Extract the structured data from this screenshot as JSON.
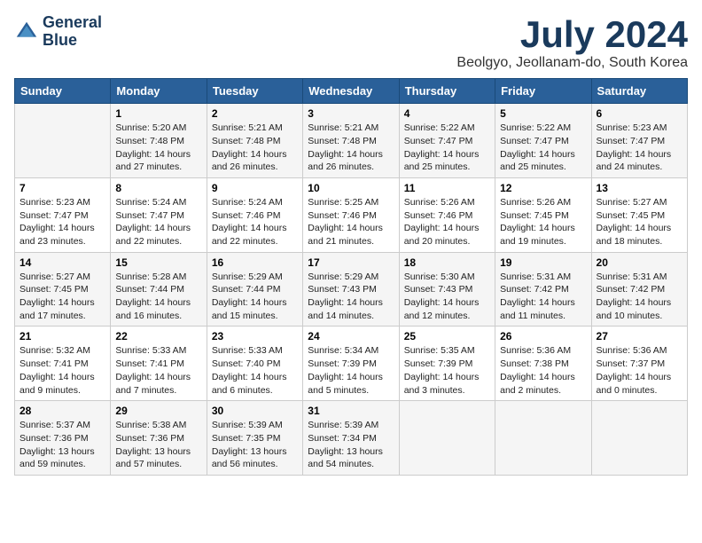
{
  "header": {
    "logo_line1": "General",
    "logo_line2": "Blue",
    "month_title": "July 2024",
    "location": "Beolgyo, Jeollanam-do, South Korea"
  },
  "weekdays": [
    "Sunday",
    "Monday",
    "Tuesday",
    "Wednesday",
    "Thursday",
    "Friday",
    "Saturday"
  ],
  "weeks": [
    [
      {
        "day": "",
        "sunrise": "",
        "sunset": "",
        "daylight": ""
      },
      {
        "day": "1",
        "sunrise": "Sunrise: 5:20 AM",
        "sunset": "Sunset: 7:48 PM",
        "daylight": "Daylight: 14 hours and 27 minutes."
      },
      {
        "day": "2",
        "sunrise": "Sunrise: 5:21 AM",
        "sunset": "Sunset: 7:48 PM",
        "daylight": "Daylight: 14 hours and 26 minutes."
      },
      {
        "day": "3",
        "sunrise": "Sunrise: 5:21 AM",
        "sunset": "Sunset: 7:48 PM",
        "daylight": "Daylight: 14 hours and 26 minutes."
      },
      {
        "day": "4",
        "sunrise": "Sunrise: 5:22 AM",
        "sunset": "Sunset: 7:47 PM",
        "daylight": "Daylight: 14 hours and 25 minutes."
      },
      {
        "day": "5",
        "sunrise": "Sunrise: 5:22 AM",
        "sunset": "Sunset: 7:47 PM",
        "daylight": "Daylight: 14 hours and 25 minutes."
      },
      {
        "day": "6",
        "sunrise": "Sunrise: 5:23 AM",
        "sunset": "Sunset: 7:47 PM",
        "daylight": "Daylight: 14 hours and 24 minutes."
      }
    ],
    [
      {
        "day": "7",
        "sunrise": "Sunrise: 5:23 AM",
        "sunset": "Sunset: 7:47 PM",
        "daylight": "Daylight: 14 hours and 23 minutes."
      },
      {
        "day": "8",
        "sunrise": "Sunrise: 5:24 AM",
        "sunset": "Sunset: 7:47 PM",
        "daylight": "Daylight: 14 hours and 22 minutes."
      },
      {
        "day": "9",
        "sunrise": "Sunrise: 5:24 AM",
        "sunset": "Sunset: 7:46 PM",
        "daylight": "Daylight: 14 hours and 22 minutes."
      },
      {
        "day": "10",
        "sunrise": "Sunrise: 5:25 AM",
        "sunset": "Sunset: 7:46 PM",
        "daylight": "Daylight: 14 hours and 21 minutes."
      },
      {
        "day": "11",
        "sunrise": "Sunrise: 5:26 AM",
        "sunset": "Sunset: 7:46 PM",
        "daylight": "Daylight: 14 hours and 20 minutes."
      },
      {
        "day": "12",
        "sunrise": "Sunrise: 5:26 AM",
        "sunset": "Sunset: 7:45 PM",
        "daylight": "Daylight: 14 hours and 19 minutes."
      },
      {
        "day": "13",
        "sunrise": "Sunrise: 5:27 AM",
        "sunset": "Sunset: 7:45 PM",
        "daylight": "Daylight: 14 hours and 18 minutes."
      }
    ],
    [
      {
        "day": "14",
        "sunrise": "Sunrise: 5:27 AM",
        "sunset": "Sunset: 7:45 PM",
        "daylight": "Daylight: 14 hours and 17 minutes."
      },
      {
        "day": "15",
        "sunrise": "Sunrise: 5:28 AM",
        "sunset": "Sunset: 7:44 PM",
        "daylight": "Daylight: 14 hours and 16 minutes."
      },
      {
        "day": "16",
        "sunrise": "Sunrise: 5:29 AM",
        "sunset": "Sunset: 7:44 PM",
        "daylight": "Daylight: 14 hours and 15 minutes."
      },
      {
        "day": "17",
        "sunrise": "Sunrise: 5:29 AM",
        "sunset": "Sunset: 7:43 PM",
        "daylight": "Daylight: 14 hours and 14 minutes."
      },
      {
        "day": "18",
        "sunrise": "Sunrise: 5:30 AM",
        "sunset": "Sunset: 7:43 PM",
        "daylight": "Daylight: 14 hours and 12 minutes."
      },
      {
        "day": "19",
        "sunrise": "Sunrise: 5:31 AM",
        "sunset": "Sunset: 7:42 PM",
        "daylight": "Daylight: 14 hours and 11 minutes."
      },
      {
        "day": "20",
        "sunrise": "Sunrise: 5:31 AM",
        "sunset": "Sunset: 7:42 PM",
        "daylight": "Daylight: 14 hours and 10 minutes."
      }
    ],
    [
      {
        "day": "21",
        "sunrise": "Sunrise: 5:32 AM",
        "sunset": "Sunset: 7:41 PM",
        "daylight": "Daylight: 14 hours and 9 minutes."
      },
      {
        "day": "22",
        "sunrise": "Sunrise: 5:33 AM",
        "sunset": "Sunset: 7:41 PM",
        "daylight": "Daylight: 14 hours and 7 minutes."
      },
      {
        "day": "23",
        "sunrise": "Sunrise: 5:33 AM",
        "sunset": "Sunset: 7:40 PM",
        "daylight": "Daylight: 14 hours and 6 minutes."
      },
      {
        "day": "24",
        "sunrise": "Sunrise: 5:34 AM",
        "sunset": "Sunset: 7:39 PM",
        "daylight": "Daylight: 14 hours and 5 minutes."
      },
      {
        "day": "25",
        "sunrise": "Sunrise: 5:35 AM",
        "sunset": "Sunset: 7:39 PM",
        "daylight": "Daylight: 14 hours and 3 minutes."
      },
      {
        "day": "26",
        "sunrise": "Sunrise: 5:36 AM",
        "sunset": "Sunset: 7:38 PM",
        "daylight": "Daylight: 14 hours and 2 minutes."
      },
      {
        "day": "27",
        "sunrise": "Sunrise: 5:36 AM",
        "sunset": "Sunset: 7:37 PM",
        "daylight": "Daylight: 14 hours and 0 minutes."
      }
    ],
    [
      {
        "day": "28",
        "sunrise": "Sunrise: 5:37 AM",
        "sunset": "Sunset: 7:36 PM",
        "daylight": "Daylight: 13 hours and 59 minutes."
      },
      {
        "day": "29",
        "sunrise": "Sunrise: 5:38 AM",
        "sunset": "Sunset: 7:36 PM",
        "daylight": "Daylight: 13 hours and 57 minutes."
      },
      {
        "day": "30",
        "sunrise": "Sunrise: 5:39 AM",
        "sunset": "Sunset: 7:35 PM",
        "daylight": "Daylight: 13 hours and 56 minutes."
      },
      {
        "day": "31",
        "sunrise": "Sunrise: 5:39 AM",
        "sunset": "Sunset: 7:34 PM",
        "daylight": "Daylight: 13 hours and 54 minutes."
      },
      {
        "day": "",
        "sunrise": "",
        "sunset": "",
        "daylight": ""
      },
      {
        "day": "",
        "sunrise": "",
        "sunset": "",
        "daylight": ""
      },
      {
        "day": "",
        "sunrise": "",
        "sunset": "",
        "daylight": ""
      }
    ]
  ]
}
